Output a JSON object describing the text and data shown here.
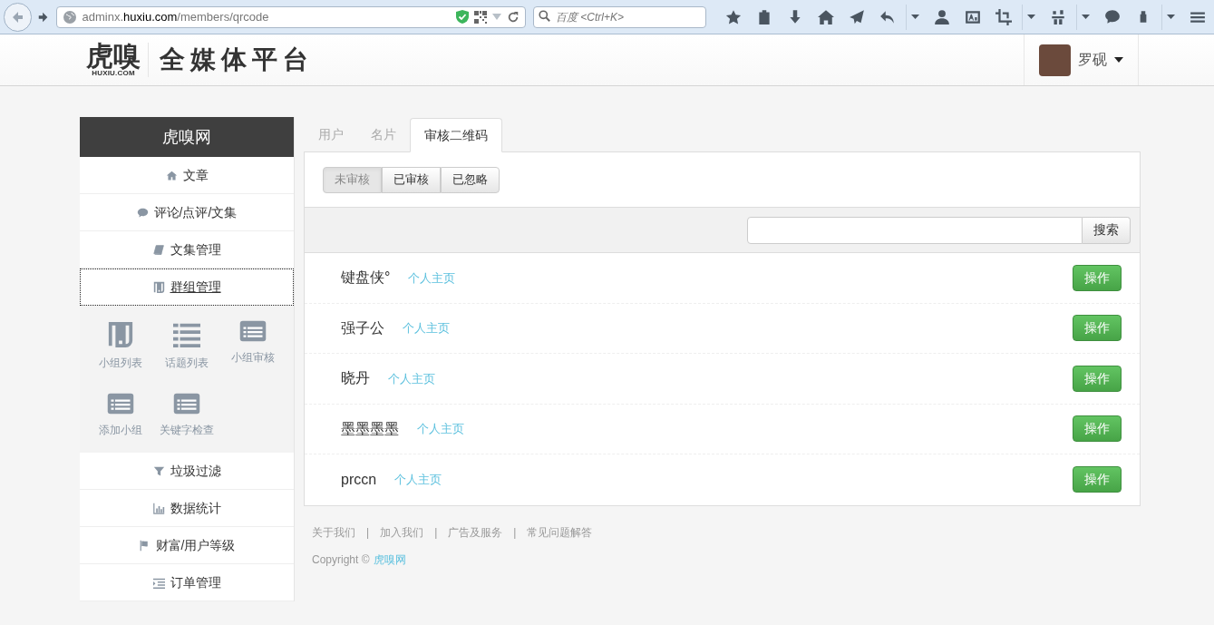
{
  "browser": {
    "url_host_prefix": "adminx.",
    "url_host": "huxiu.com",
    "url_path": "/members/qrcode",
    "search_placeholder": "百度 <Ctrl+K>"
  },
  "header": {
    "logo_text": "虎嗅",
    "logo_sub": "HUXIU.COM",
    "platform_title": "全媒体平台",
    "user_name": "罗砚"
  },
  "sidebar": {
    "title": "虎嗅网",
    "items": [
      {
        "label": "文章",
        "selected": false
      },
      {
        "label": "评论/点评/文集",
        "selected": false
      },
      {
        "label": "文集管理",
        "selected": false
      },
      {
        "label": "群组管理",
        "selected": true,
        "expanded": true,
        "children": [
          {
            "label": "小组列表"
          },
          {
            "label": "话题列表"
          },
          {
            "label": "小组审核"
          },
          {
            "label": "添加小组"
          },
          {
            "label": "关键字检查"
          }
        ]
      },
      {
        "label": "垃圾过滤",
        "selected": false
      },
      {
        "label": "数据统计",
        "selected": false
      },
      {
        "label": "财富/用户等级",
        "selected": false
      },
      {
        "label": "订单管理",
        "selected": false
      }
    ]
  },
  "tabs": [
    {
      "label": "用户",
      "selected": false
    },
    {
      "label": "名片",
      "selected": false
    },
    {
      "label": "审核二维码",
      "selected": true
    }
  ],
  "filters": [
    {
      "label": "未审核",
      "selected": true
    },
    {
      "label": "已审核",
      "selected": false
    },
    {
      "label": "已忽略",
      "selected": false
    }
  ],
  "search": {
    "button": "搜索"
  },
  "rows": [
    {
      "name": "键盘侠°",
      "link": "个人主页",
      "action": "操作"
    },
    {
      "name": "强子公",
      "link": "个人主页",
      "action": "操作"
    },
    {
      "name": "晓丹",
      "link": "个人主页",
      "action": "操作"
    },
    {
      "name": "墨墨墨墨",
      "link": "个人主页",
      "action": "操作"
    },
    {
      "name": "prccn",
      "link": "个人主页",
      "action": "操作"
    }
  ],
  "footer": {
    "links": [
      "关于我们",
      "加入我们",
      "广告及服务",
      "常见问题解答"
    ],
    "separator": "|",
    "copyright": "Copyright ©",
    "copyright_link": "虎嗅网"
  }
}
